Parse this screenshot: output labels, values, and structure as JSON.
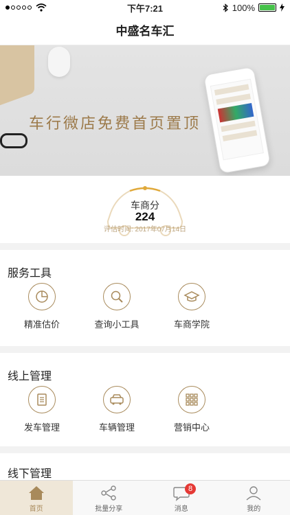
{
  "status_bar": {
    "time": "下午7:21",
    "battery": "100%"
  },
  "nav": {
    "title": "中盛名车汇"
  },
  "banner": {
    "text": "车行微店免费首页置顶"
  },
  "score": {
    "label": "车商分",
    "value": "224",
    "date": "评估时间: 2017年07月14日"
  },
  "sections": [
    {
      "title": "服务工具",
      "items": [
        {
          "label": "精准估价",
          "icon": "pie-chart-icon"
        },
        {
          "label": "查询小工具",
          "icon": "search-icon"
        },
        {
          "label": "车商学院",
          "icon": "graduation-cap-icon"
        }
      ]
    },
    {
      "title": "线上管理",
      "items": [
        {
          "label": "发车管理",
          "icon": "clipboard-icon"
        },
        {
          "label": "车辆管理",
          "icon": "car-icon"
        },
        {
          "label": "营销中心",
          "icon": "grid-icon"
        }
      ]
    },
    {
      "title": "线下管理",
      "items": []
    }
  ],
  "tabs": [
    {
      "label": "首页",
      "icon": "home-icon",
      "active": true
    },
    {
      "label": "批量分享",
      "icon": "share-icon",
      "active": false
    },
    {
      "label": "消息",
      "icon": "message-icon",
      "active": false,
      "badge": "8"
    },
    {
      "label": "我的",
      "icon": "user-icon",
      "active": false
    }
  ],
  "colors": {
    "accent": "#a88a5b",
    "badge": "#e53935",
    "battery": "#46c24a"
  }
}
